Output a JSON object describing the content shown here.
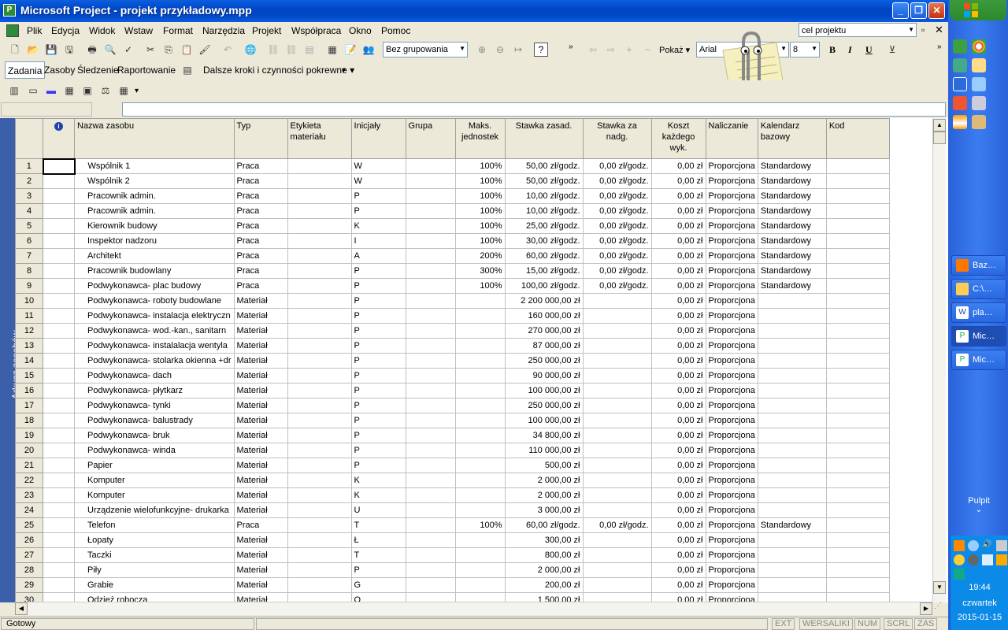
{
  "window": {
    "title": "Microsoft Project - projekt przykładowy.mpp"
  },
  "menu": [
    "Plik",
    "Edycja",
    "Widok",
    "Wstaw",
    "Format",
    "Narzędzia",
    "Projekt",
    "Współpraca",
    "Okno",
    "Pomoc"
  ],
  "help_box": "cel projektu",
  "toolbar": {
    "grouping": "Bez grupowania",
    "show": "Pokaż",
    "font": "Arial",
    "font_size": "8",
    "bold": "B",
    "italic": "I",
    "underline": "U"
  },
  "guide_toolbar": {
    "tabs": [
      "Zadania",
      "Zasoby",
      "Śledzenie",
      "Raportowanie"
    ],
    "next_steps": "Dalsze kroki i czynności pokrewne"
  },
  "view_bar_label": "Arkusz zasobów",
  "columns": [
    "Nazwa zasobu",
    "Typ",
    "Etykieta materiału",
    "Inicjały",
    "Grupa",
    "Maks. jednostek",
    "Stawka zasad.",
    "Stawka za nadg.",
    "Koszt każdego wyk.",
    "Naliczanie",
    "Kalendarz bazowy",
    "Kod"
  ],
  "rows": [
    [
      "1",
      "Wspólnik 1",
      "Praca",
      "",
      "W",
      "",
      "100%",
      "50,00 zł/godz.",
      "0,00 zł/godz.",
      "0,00 zł",
      "Proporcjona",
      "Standardowy"
    ],
    [
      "2",
      "Wspólnik 2",
      "Praca",
      "",
      "W",
      "",
      "100%",
      "50,00 zł/godz.",
      "0,00 zł/godz.",
      "0,00 zł",
      "Proporcjona",
      "Standardowy"
    ],
    [
      "3",
      "Pracownik admin.",
      "Praca",
      "",
      "P",
      "",
      "100%",
      "10,00 zł/godz.",
      "0,00 zł/godz.",
      "0,00 zł",
      "Proporcjona",
      "Standardowy"
    ],
    [
      "4",
      "Pracownik admin.",
      "Praca",
      "",
      "P",
      "",
      "100%",
      "10,00 zł/godz.",
      "0,00 zł/godz.",
      "0,00 zł",
      "Proporcjona",
      "Standardowy"
    ],
    [
      "5",
      "Kierownik budowy",
      "Praca",
      "",
      "K",
      "",
      "100%",
      "25,00 zł/godz.",
      "0,00 zł/godz.",
      "0,00 zł",
      "Proporcjona",
      "Standardowy"
    ],
    [
      "6",
      "Inspektor nadzoru",
      "Praca",
      "",
      "I",
      "",
      "100%",
      "30,00 zł/godz.",
      "0,00 zł/godz.",
      "0,00 zł",
      "Proporcjona",
      "Standardowy"
    ],
    [
      "7",
      "Architekt",
      "Praca",
      "",
      "A",
      "",
      "200%",
      "60,00 zł/godz.",
      "0,00 zł/godz.",
      "0,00 zł",
      "Proporcjona",
      "Standardowy"
    ],
    [
      "8",
      "Pracownik budowlany",
      "Praca",
      "",
      "P",
      "",
      "300%",
      "15,00 zł/godz.",
      "0,00 zł/godz.",
      "0,00 zł",
      "Proporcjona",
      "Standardowy"
    ],
    [
      "9",
      "Podwykonawca- plac budowy",
      "Praca",
      "",
      "P",
      "",
      "100%",
      "100,00 zł/godz.",
      "0,00 zł/godz.",
      "0,00 zł",
      "Proporcjona",
      "Standardowy"
    ],
    [
      "10",
      "Podwykonawca- roboty budowlane",
      "Materiał",
      "",
      "P",
      "",
      "",
      "2 200 000,00 zł",
      "",
      "0,00 zł",
      "Proporcjona",
      ""
    ],
    [
      "11",
      "Podwykonawca- instalacja elektryczn",
      "Materiał",
      "",
      "P",
      "",
      "",
      "160 000,00 zł",
      "",
      "0,00 zł",
      "Proporcjona",
      ""
    ],
    [
      "12",
      "Podwykonawca- wod.-kan., sanitarn",
      "Materiał",
      "",
      "P",
      "",
      "",
      "270 000,00 zł",
      "",
      "0,00 zł",
      "Proporcjona",
      ""
    ],
    [
      "13",
      "Podwykonawca- instalalacja wentyla",
      "Materiał",
      "",
      "P",
      "",
      "",
      "87 000,00 zł",
      "",
      "0,00 zł",
      "Proporcjona",
      ""
    ],
    [
      "14",
      "Podwykonawca- stolarka okienna +dr",
      "Materiał",
      "",
      "P",
      "",
      "",
      "250 000,00 zł",
      "",
      "0,00 zł",
      "Proporcjona",
      ""
    ],
    [
      "15",
      "Podwykonawca- dach",
      "Materiał",
      "",
      "P",
      "",
      "",
      "90 000,00 zł",
      "",
      "0,00 zł",
      "Proporcjona",
      ""
    ],
    [
      "16",
      "Podwykonawca- płytkarz",
      "Materiał",
      "",
      "P",
      "",
      "",
      "100 000,00 zł",
      "",
      "0,00 zł",
      "Proporcjona",
      ""
    ],
    [
      "17",
      "Podwykonawca- tynki",
      "Materiał",
      "",
      "P",
      "",
      "",
      "250 000,00 zł",
      "",
      "0,00 zł",
      "Proporcjona",
      ""
    ],
    [
      "18",
      "Podwykonawca- balustrady",
      "Materiał",
      "",
      "P",
      "",
      "",
      "100 000,00 zł",
      "",
      "0,00 zł",
      "Proporcjona",
      ""
    ],
    [
      "19",
      "Podwykonawca- bruk",
      "Materiał",
      "",
      "P",
      "",
      "",
      "34 800,00 zł",
      "",
      "0,00 zł",
      "Proporcjona",
      ""
    ],
    [
      "20",
      "Podwykonawca- winda",
      "Materiał",
      "",
      "P",
      "",
      "",
      "110 000,00 zł",
      "",
      "0,00 zł",
      "Proporcjona",
      ""
    ],
    [
      "21",
      "Papier",
      "Materiał",
      "",
      "P",
      "",
      "",
      "500,00 zł",
      "",
      "0,00 zł",
      "Proporcjona",
      ""
    ],
    [
      "22",
      "Komputer",
      "Materiał",
      "",
      "K",
      "",
      "",
      "2 000,00 zł",
      "",
      "0,00 zł",
      "Proporcjona",
      ""
    ],
    [
      "23",
      "Komputer",
      "Materiał",
      "",
      "K",
      "",
      "",
      "2 000,00 zł",
      "",
      "0,00 zł",
      "Proporcjona",
      ""
    ],
    [
      "24",
      "Urządzenie wielofunkcyjne- drukarka",
      "Materiał",
      "",
      "U",
      "",
      "",
      "3 000,00 zł",
      "",
      "0,00 zł",
      "Proporcjona",
      ""
    ],
    [
      "25",
      "Telefon",
      "Praca",
      "",
      "T",
      "",
      "100%",
      "60,00 zł/godz.",
      "0,00 zł/godz.",
      "0,00 zł",
      "Proporcjona",
      "Standardowy"
    ],
    [
      "26",
      "Łopaty",
      "Materiał",
      "",
      "Ł",
      "",
      "",
      "300,00 zł",
      "",
      "0,00 zł",
      "Proporcjona",
      ""
    ],
    [
      "27",
      "Taczki",
      "Materiał",
      "",
      "T",
      "",
      "",
      "800,00 zł",
      "",
      "0,00 zł",
      "Proporcjona",
      ""
    ],
    [
      "28",
      "Piły",
      "Materiał",
      "",
      "P",
      "",
      "",
      "2 000,00 zł",
      "",
      "0,00 zł",
      "Proporcjona",
      ""
    ],
    [
      "29",
      "Grabie",
      "Materiał",
      "",
      "G",
      "",
      "",
      "200,00 zł",
      "",
      "0,00 zł",
      "Proporcjona",
      ""
    ],
    [
      "30",
      "Odzież robocza",
      "Materiał",
      "",
      "O",
      "",
      "",
      "1 500,00 zł",
      "",
      "0,00 zł",
      "Proporcjona",
      ""
    ]
  ],
  "status": {
    "ready": "Gotowy",
    "panes": [
      "EXT",
      "WERSALIKI",
      "NUM",
      "SCRL",
      "ZAS"
    ]
  },
  "taskbar": {
    "buttons": [
      "Baz…",
      "C:\\…",
      "pla…",
      "Mic…",
      "Mic…"
    ],
    "desktop": "Pulpit",
    "time": "19:44",
    "day": "czwartek",
    "date": "2015-01-15"
  }
}
